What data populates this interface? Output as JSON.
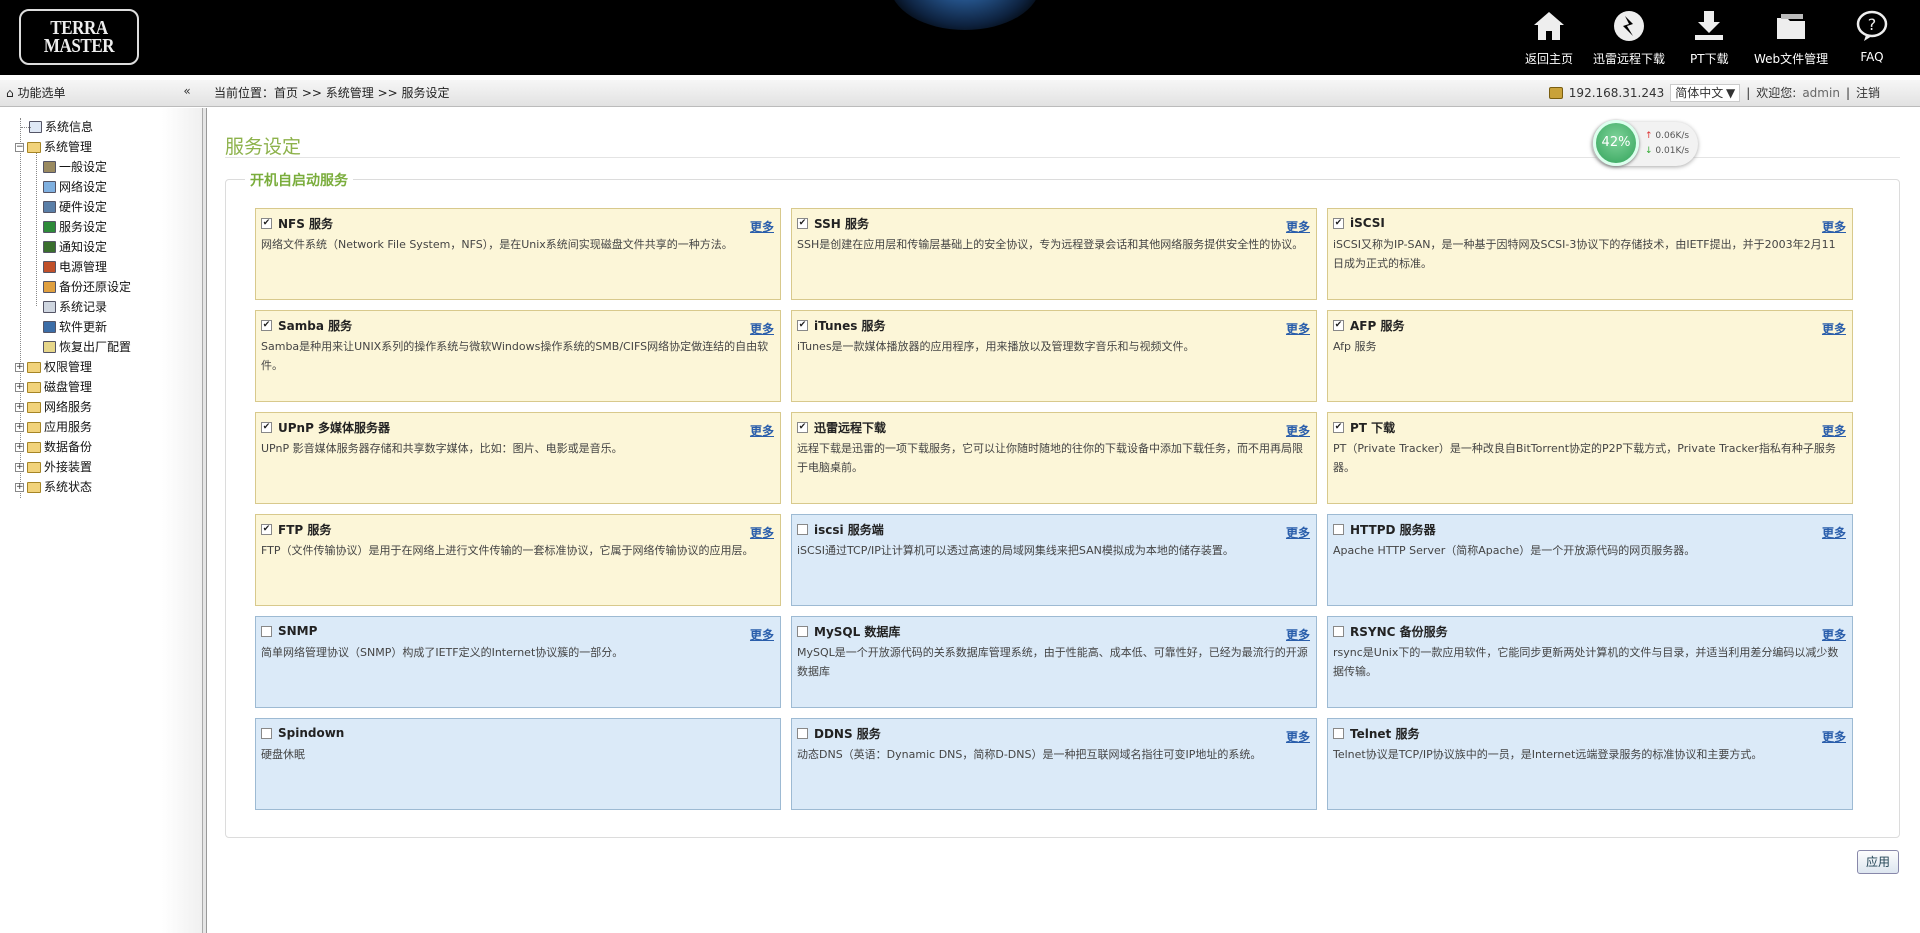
{
  "header": {
    "logo_text": "TERRA MASTER",
    "nav": [
      {
        "label": "返回主页",
        "icon": "home-icon"
      },
      {
        "label": "迅雷远程下载",
        "icon": "thunder-icon"
      },
      {
        "label": "PT下载",
        "icon": "download-icon"
      },
      {
        "label": "Web文件管理",
        "icon": "folder-icon"
      },
      {
        "label": "FAQ",
        "icon": "help-icon"
      }
    ]
  },
  "subbar": {
    "menu_title": "功能选单",
    "collapse_symbol": "«",
    "breadcrumb_prefix": "当前位置：",
    "breadcrumb": [
      "首页",
      "系统管理",
      "服务设定"
    ],
    "breadcrumb_sep": " >> ",
    "ip": "192.168.31.243",
    "language": "简体中文",
    "welcome": "欢迎您:",
    "username": "admin",
    "logout": "注销",
    "sep": "|"
  },
  "sidebar": {
    "items": [
      {
        "label": "系统信息"
      },
      {
        "label": "系统管理"
      },
      {
        "label": "一般设定"
      },
      {
        "label": "网络设定"
      },
      {
        "label": "硬件设定"
      },
      {
        "label": "服务设定"
      },
      {
        "label": "通知设定"
      },
      {
        "label": "电源管理"
      },
      {
        "label": "备份还原设定"
      },
      {
        "label": "系统记录"
      },
      {
        "label": "软件更新"
      },
      {
        "label": "恢复出厂配置"
      },
      {
        "label": "权限管理"
      },
      {
        "label": "磁盘管理"
      },
      {
        "label": "网络服务"
      },
      {
        "label": "应用服务"
      },
      {
        "label": "数据备份"
      },
      {
        "label": "外接装置"
      },
      {
        "label": "系统状态"
      }
    ]
  },
  "main": {
    "title": "服务设定",
    "section_legend": "开机自启动服务",
    "more_label": "更多",
    "apply_label": "应用",
    "widget": {
      "percent": "42%",
      "up_speed": "0.06K/s",
      "down_speed": "0.01K/s"
    },
    "services": [
      {
        "name": "NFS 服务",
        "checked": true,
        "desc": "网络文件系统（Network File System，NFS），是在Unix系统间实现磁盘文件共享的一种方法。"
      },
      {
        "name": "SSH 服务",
        "checked": true,
        "desc": "SSH是创建在应用层和传输层基础上的安全协议，专为远程登录会话和其他网络服务提供安全性的协议。"
      },
      {
        "name": "iSCSI",
        "checked": true,
        "desc": "iSCSI又称为IP-SAN，是一种基于因特网及SCSI-3协议下的存储技术，由IETF提出，并于2003年2月11日成为正式的标准。"
      },
      {
        "name": "Samba 服务",
        "checked": true,
        "desc": "Samba是种用来让UNIX系列的操作系统与微软Windows操作系统的SMB/CIFS网络协定做连结的自由软件。"
      },
      {
        "name": "iTunes 服务",
        "checked": true,
        "desc": "iTunes是一款媒体播放器的应用程序，用来播放以及管理数字音乐和与视频文件。"
      },
      {
        "name": "AFP 服务",
        "checked": true,
        "desc": "Afp 服务"
      },
      {
        "name": "UPnP 多媒体服务器",
        "checked": true,
        "desc": "UPnP 影音媒体服务器存储和共享数字媒体，比如：图片、电影或是音乐。"
      },
      {
        "name": "迅雷远程下载",
        "checked": true,
        "desc": "远程下载是迅雷的一项下载服务，它可以让你随时随地的往你的下载设备中添加下载任务，而不用再局限于电脑桌前。"
      },
      {
        "name": "PT 下载",
        "checked": true,
        "desc": "PT（Private Tracker）是一种改良自BitTorrent协定的P2P下载方式，Private Tracker指私有种子服务器。"
      },
      {
        "name": "FTP 服务",
        "checked": true,
        "desc": "FTP（文件传输协议）是用于在网络上进行文件传输的一套标准协议，它属于网络传输协议的应用层。"
      },
      {
        "name": "iscsi 服务端",
        "checked": false,
        "desc": "iSCSI通过TCP/IP让计算机可以透过高速的局域网集线来把SAN模拟成为本地的储存装置。"
      },
      {
        "name": "HTTPD 服务器",
        "checked": false,
        "desc": "Apache HTTP Server（简称Apache）是一个开放源代码的网页服务器。"
      },
      {
        "name": "SNMP",
        "checked": false,
        "desc": "简单网络管理协议（SNMP）构成了IETF定义的Internet协议簇的一部分。"
      },
      {
        "name": "MySQL 数据库",
        "checked": false,
        "desc": "MySQL是一个开放源代码的关系数据库管理系统，由于性能高、成本低、可靠性好，已经为最流行的开源数据库"
      },
      {
        "name": "RSYNC 备份服务",
        "checked": false,
        "desc": "rsync是Unix下的一款应用软件，它能同步更新两处计算机的文件与目录，并适当利用差分编码以减少数据传输。"
      },
      {
        "name": "Spindown",
        "checked": false,
        "desc": "硬盘休眠",
        "no_more": true
      },
      {
        "name": "DDNS 服务",
        "checked": false,
        "desc": "动态DNS（英语：Dynamic DNS，简称D-DNS）是一种把互联网域名指往可变IP地址的系统。"
      },
      {
        "name": "Telnet 服务",
        "checked": false,
        "desc": "Telnet协议是TCP/IP协议族中的一员，是Internet远端登录服务的标准协议和主要方式。"
      }
    ]
  }
}
